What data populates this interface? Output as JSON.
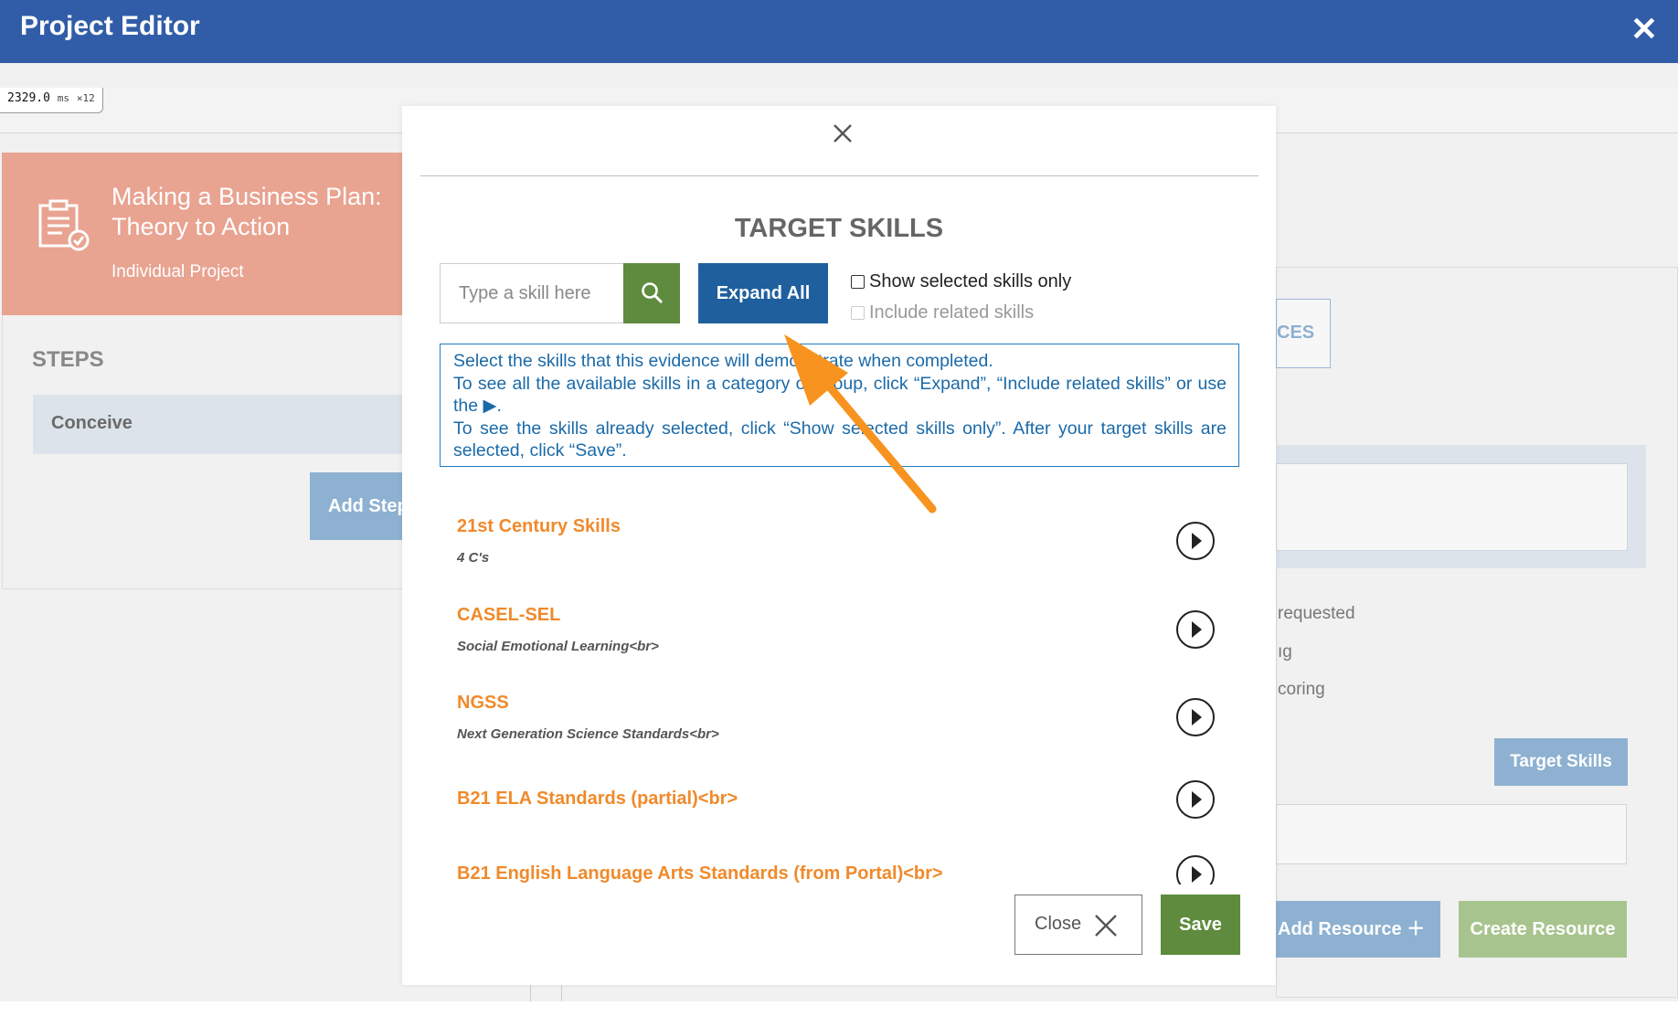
{
  "header": {
    "title": "Project Editor",
    "close_glyph": "✕"
  },
  "perf": {
    "value": "2329.0",
    "unit": "ms",
    "count": "×12"
  },
  "project": {
    "title": "Making a Business Plan: Theory to Action",
    "type": "Individual Project"
  },
  "steps": {
    "label": "STEPS",
    "items": [
      {
        "label": "Conceive"
      }
    ],
    "add_label": "Add Step"
  },
  "right": {
    "tab_fragment": "CES",
    "lines": [
      "requested",
      "ıg",
      "coring"
    ],
    "target_skills_label": "Target Skills",
    "add_resource_label": "Add Resource",
    "create_resource_label": "Create Resource"
  },
  "modal": {
    "title": "TARGET SKILLS",
    "search": {
      "placeholder": "Type a skill here",
      "value": ""
    },
    "expand_all_label": "Expand All",
    "show_selected_label": "Show selected skills only",
    "include_related_label": "Include related skills",
    "info": [
      "Select the skills that this evidence will demonstrate when completed.",
      "To see all the available skills in a category or group, click “Expand”, “Include related skills” or use the ▶.",
      "To see the skills already selected, click “Show selected skills only”. After your target skills are selected, click “Save”."
    ],
    "skills": [
      {
        "name": "21st Century Skills",
        "desc": "4 C's"
      },
      {
        "name": "CASEL-SEL",
        "desc": "Social Emotional Learning<br>"
      },
      {
        "name": "NGSS",
        "desc": "Next Generation Science Standards<br>"
      },
      {
        "name": "B21 ELA Standards (partial)<br>",
        "desc": ""
      },
      {
        "name": "B21 English Language Arts Standards (from Portal)<br>",
        "desc": ""
      }
    ],
    "close_label": "Close",
    "save_label": "Save"
  },
  "colors": {
    "header": "#315da8",
    "accent_orange": "#f08a2b",
    "green": "#5e8b3d",
    "blue_button": "#1f5f9e"
  }
}
